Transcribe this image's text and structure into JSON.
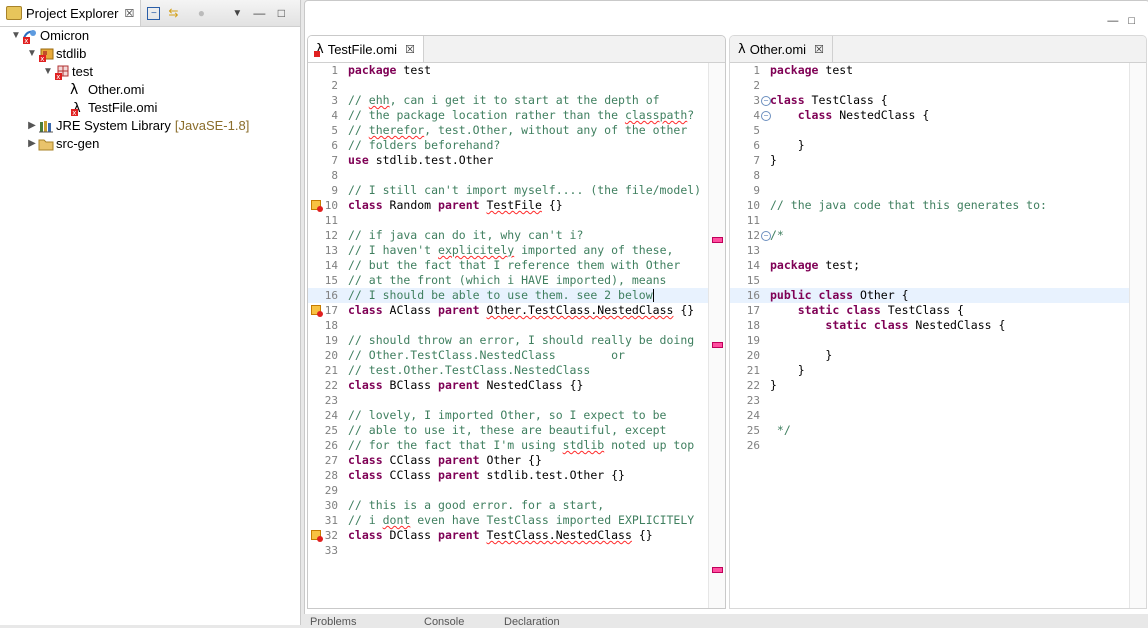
{
  "explorer": {
    "tab_label": "Project Explorer",
    "tree": [
      {
        "label": "Omicron",
        "extra": "",
        "expanded": true
      },
      {
        "label": "stdlib",
        "extra": "",
        "expanded": true
      },
      {
        "label": "test",
        "extra": "",
        "expanded": true
      },
      {
        "label": "Other.omi",
        "extra": ""
      },
      {
        "label": "TestFile.omi",
        "extra": ""
      },
      {
        "label": "JRE System Library",
        "extra": "[JavaSE-1.8]",
        "expanded": false
      },
      {
        "label": "src-gen",
        "extra": "",
        "expanded": false
      }
    ]
  },
  "editor_left": {
    "tab_label": "TestFile.omi",
    "lines": [
      {
        "n": "1",
        "text": "package test"
      },
      {
        "n": "2",
        "text": ""
      },
      {
        "n": "3",
        "text": "// ehh, can i get it to start at the depth of"
      },
      {
        "n": "4",
        "text": "// the package location rather than the classpath?"
      },
      {
        "n": "5",
        "text": "// therefor, test.Other, without any of the other"
      },
      {
        "n": "6",
        "text": "// folders beforehand?"
      },
      {
        "n": "7",
        "text": "use stdlib.test.Other"
      },
      {
        "n": "8",
        "text": ""
      },
      {
        "n": "9",
        "text": "// I still can't import myself.... (the file/model)"
      },
      {
        "n": "10",
        "text": "class Random parent TestFile {}"
      },
      {
        "n": "11",
        "text": ""
      },
      {
        "n": "12",
        "text": "// if java can do it, why can't i?"
      },
      {
        "n": "13",
        "text": "// I haven't explicitely imported any of these,"
      },
      {
        "n": "14",
        "text": "// but the fact that I reference them with Other"
      },
      {
        "n": "15",
        "text": "// at the front (which i HAVE imported), means"
      },
      {
        "n": "16",
        "text": "// I should be able to use them. see 2 below"
      },
      {
        "n": "17",
        "text": "class AClass parent Other.TestClass.NestedClass {}"
      },
      {
        "n": "18",
        "text": ""
      },
      {
        "n": "19",
        "text": "// should throw an error, I should really be doing"
      },
      {
        "n": "20",
        "text": "// Other.TestClass.NestedClass        or"
      },
      {
        "n": "21",
        "text": "// test.Other.TestClass.NestedClass"
      },
      {
        "n": "22",
        "text": "class BClass parent NestedClass {}"
      },
      {
        "n": "23",
        "text": ""
      },
      {
        "n": "24",
        "text": "// lovely, I imported Other, so I expect to be"
      },
      {
        "n": "25",
        "text": "// able to use it, these are beautiful, except"
      },
      {
        "n": "26",
        "text": "// for the fact that I'm using stdlib noted up top"
      },
      {
        "n": "27",
        "text": "class CClass parent Other {}"
      },
      {
        "n": "28",
        "text": "class CClass parent stdlib.test.Other {}"
      },
      {
        "n": "29",
        "text": ""
      },
      {
        "n": "30",
        "text": "// this is a good error. for a start,"
      },
      {
        "n": "31",
        "text": "// i dont even have TestClass imported EXPLICITELY"
      },
      {
        "n": "32",
        "text": "class DClass parent TestClass.NestedClass {}"
      },
      {
        "n": "33",
        "text": ""
      }
    ]
  },
  "editor_right": {
    "tab_label": "Other.omi",
    "lines": [
      {
        "n": "1",
        "text": "package test"
      },
      {
        "n": "2",
        "text": ""
      },
      {
        "n": "3",
        "text": "class TestClass {"
      },
      {
        "n": "4",
        "text": "    class NestedClass {"
      },
      {
        "n": "5",
        "text": ""
      },
      {
        "n": "6",
        "text": "    }"
      },
      {
        "n": "7",
        "text": "}"
      },
      {
        "n": "8",
        "text": ""
      },
      {
        "n": "9",
        "text": ""
      },
      {
        "n": "10",
        "text": "// the java code that this generates to:"
      },
      {
        "n": "11",
        "text": ""
      },
      {
        "n": "12",
        "text": "/*"
      },
      {
        "n": "13",
        "text": ""
      },
      {
        "n": "14",
        "text": "package test;"
      },
      {
        "n": "15",
        "text": ""
      },
      {
        "n": "16",
        "text": "public class Other {"
      },
      {
        "n": "17",
        "text": "    static class TestClass {"
      },
      {
        "n": "18",
        "text": "        static class NestedClass {"
      },
      {
        "n": "19",
        "text": ""
      },
      {
        "n": "20",
        "text": "        }"
      },
      {
        "n": "21",
        "text": "    }"
      },
      {
        "n": "22",
        "text": "}"
      },
      {
        "n": "23",
        "text": ""
      },
      {
        "n": "24",
        "text": ""
      },
      {
        "n": "25",
        "text": " */"
      },
      {
        "n": "26",
        "text": ""
      }
    ]
  },
  "bottom_tabs": [
    "Problems",
    "Console",
    "Declaration"
  ]
}
